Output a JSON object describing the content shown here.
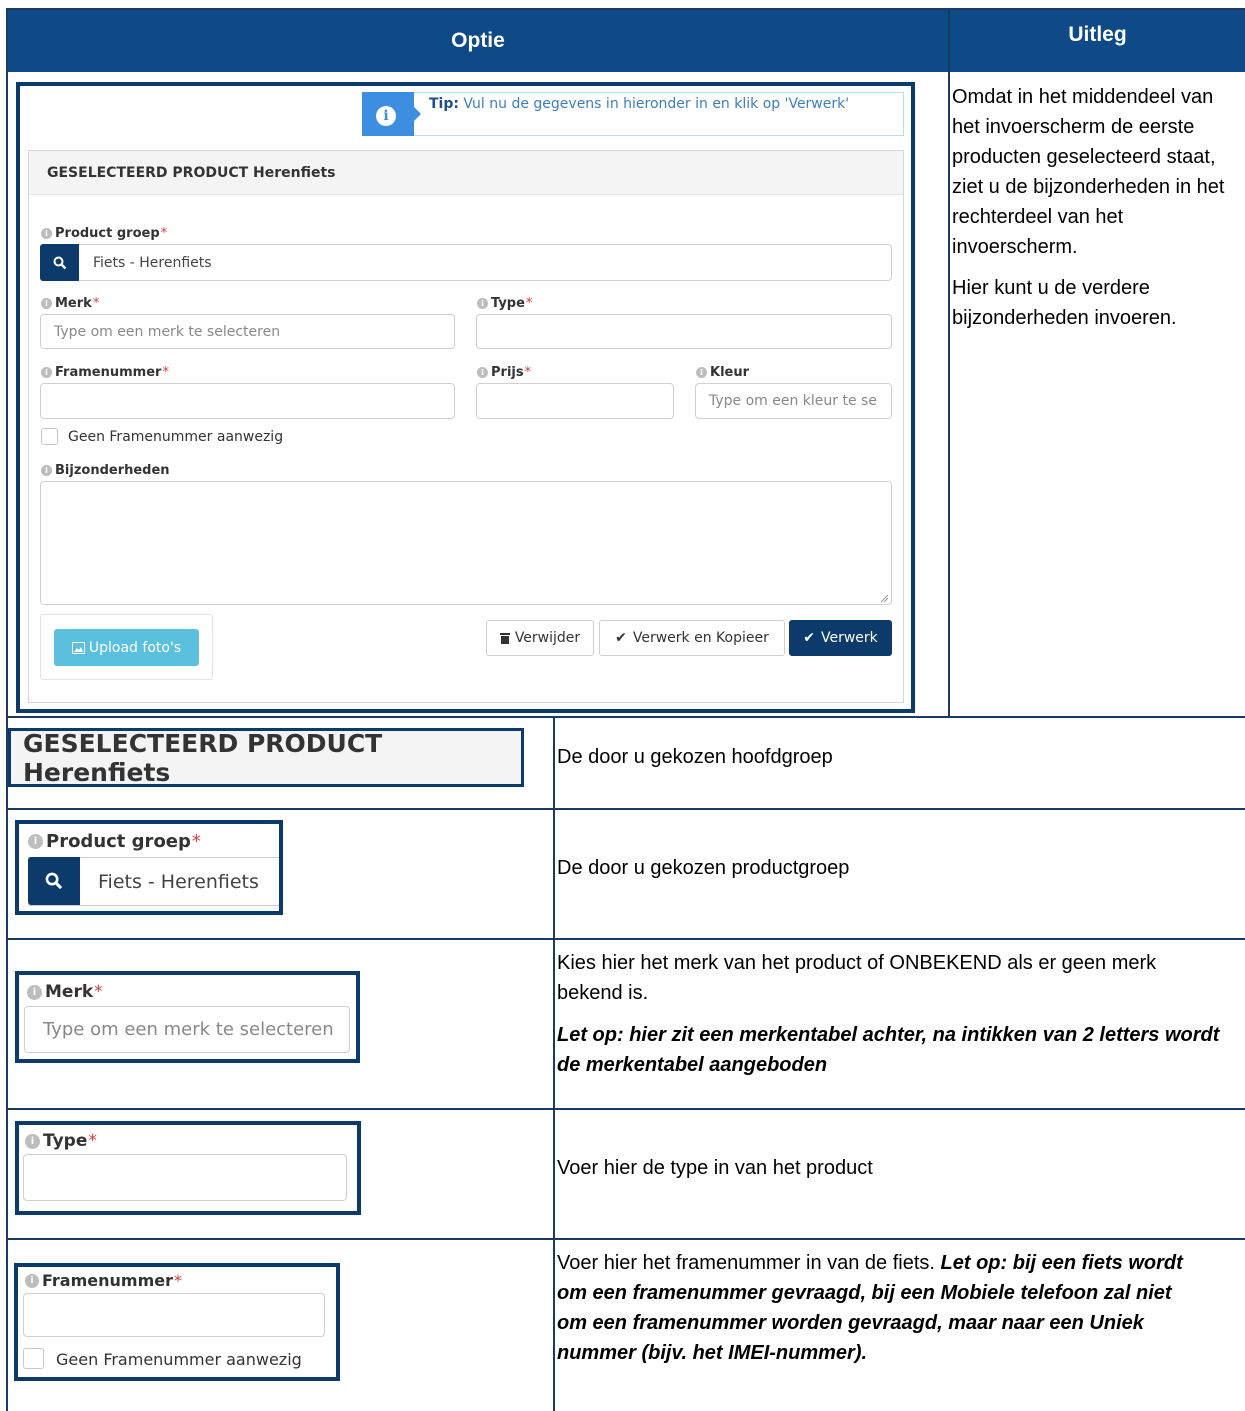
{
  "header": {
    "optie": "Optie",
    "uitleg": "Uitleg"
  },
  "row1": {
    "uitleg_p1": "Omdat in het middendeel van het invoerscherm de eerste producten geselecteerd staat, ziet u de bijzonderheden in het rechterdeel van het invoerscherm.",
    "uitleg_p2": "Hier kunt u de verdere bijzonderheden invoeren.",
    "screenshot": {
      "tip_label": "Tip:",
      "tip_text": "Vul nu de gegevens in hieronder in en klik op 'Verwerk'",
      "panel_title": "GESELECTEERD PRODUCT Herenfiets",
      "product_groep_label": "Product groep",
      "product_groep_value": "Fiets - Herenfiets",
      "merk_label": "Merk",
      "merk_placeholder": "Type om een merk te selecteren",
      "type_label": "Type",
      "framenummer_label": "Framenummer",
      "prijs_label": "Prijs",
      "kleur_label": "Kleur",
      "kleur_placeholder": "Type om een kleur te se",
      "geen_framenummer": "Geen Framenummer aanwezig",
      "bijzonderheden_label": "Bijzonderheden",
      "upload_label": "Upload foto's",
      "verwijder_label": "Verwijder",
      "verwerk_kopieer_label": "Verwerk en Kopieer",
      "verwerk_label": "Verwerk",
      "required_mark": "*"
    }
  },
  "row2": {
    "image_text": "GESELECTEERD PRODUCT Herenfiets",
    "uitleg": "De door u gekozen hoofdgroep"
  },
  "row3": {
    "label": "Product groep",
    "value": "Fiets - Herenfiets",
    "uitleg": "De door u gekozen productgroep"
  },
  "row4": {
    "label": "Merk",
    "placeholder": "Type om een merk te selecteren",
    "uitleg_p1": "Kies hier het merk van het product of ONBEKEND als er geen merk bekend is.",
    "uitleg_p2": "Let op: hier zit een merkentabel achter, na intikken van 2 letters wordt de merkentabel aangeboden"
  },
  "row5": {
    "label": "Type",
    "uitleg": "Voer hier de type in van het product"
  },
  "row6": {
    "label": "Framenummer",
    "checkbox_label": "Geen Framenummer aanwezig",
    "uitleg_normal": "Voer hier het framenummer in van de fiets.",
    "uitleg_bold": "Let op: bij een fiets wordt om een framenummer gevraagd, bij een Mobiele telefoon zal niet om een framenummer worden gevraagd, maar naar een Uniek nummer (bijv. het IMEI-nummer)."
  }
}
